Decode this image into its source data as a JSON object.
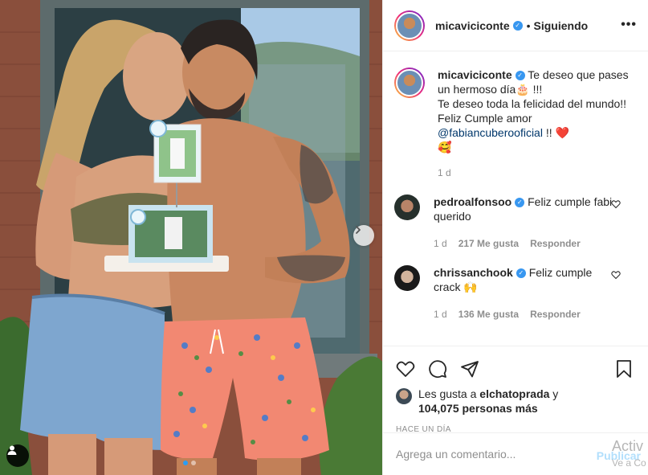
{
  "post": {
    "username": "micaviciconte",
    "following_label": "Siguiendo",
    "more_label": "•••"
  },
  "caption": {
    "username": "micaviciconte",
    "line1": "Te deseo que pases un hermoso día",
    "line1_end": " !!!",
    "line2": "Te deseo toda la felicidad del mundo!!",
    "line3": "Feliz Cumple amor",
    "mention": "@fabiancuberooficial",
    "mention_end": " !!",
    "emoji_cake": "🎂",
    "emoji_love": "❤️",
    "emoji_smile": "🥰",
    "time": "1 d"
  },
  "comments": [
    {
      "username": "pedroalfonsoo",
      "text": "Feliz cumple fabi querido",
      "time": "1 d",
      "likes": "217 Me gusta",
      "reply": "Responder"
    },
    {
      "username": "chrissanchook",
      "text": "Feliz cumple crack 🙌",
      "time": "1 d",
      "likes": "136 Me gusta",
      "reply": "Responder"
    }
  ],
  "likes": {
    "prefix": "Les gusta a ",
    "user": "elchatoprada",
    "suffix": " y",
    "count": "104,075 personas más"
  },
  "time_ago": "HACE UN DÍA",
  "add_comment": {
    "placeholder": "Agrega un comentario...",
    "publish": "Publicar"
  },
  "watermark": {
    "line1": "Activ",
    "line2": "Ve a Co"
  },
  "colors": {
    "verified": "#3897f0",
    "link": "#00376b",
    "muted": "#8e8e8e",
    "publish": "#b2dffc",
    "carousel_active": "#2a9df4"
  },
  "icons": {
    "like": "heart-icon",
    "comment": "comment-icon",
    "share": "paper-plane-icon",
    "save": "bookmark-icon",
    "tag": "user-tag-icon",
    "next": "chevron-right-icon"
  }
}
